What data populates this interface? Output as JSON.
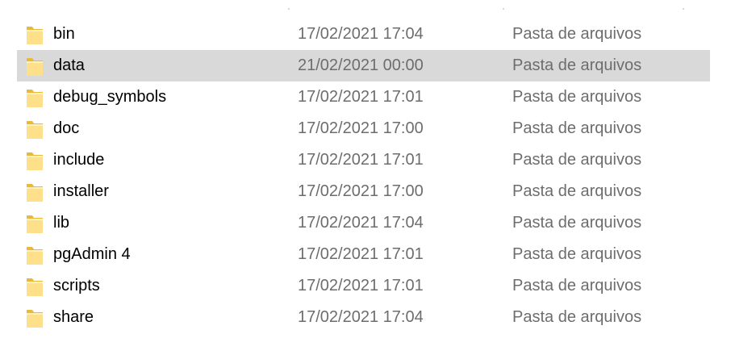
{
  "explorer": {
    "rows": [
      {
        "name": "bin",
        "modified": "17/02/2021 17:04",
        "type": "Pasta de arquivos",
        "icon": "folder-icon",
        "selected": false
      },
      {
        "name": "data",
        "modified": "21/02/2021 00:00",
        "type": "Pasta de arquivos",
        "icon": "folder-icon",
        "selected": true
      },
      {
        "name": "debug_symbols",
        "modified": "17/02/2021 17:01",
        "type": "Pasta de arquivos",
        "icon": "folder-icon",
        "selected": false
      },
      {
        "name": "doc",
        "modified": "17/02/2021 17:00",
        "type": "Pasta de arquivos",
        "icon": "folder-icon",
        "selected": false
      },
      {
        "name": "include",
        "modified": "17/02/2021 17:01",
        "type": "Pasta de arquivos",
        "icon": "folder-icon",
        "selected": false
      },
      {
        "name": "installer",
        "modified": "17/02/2021 17:00",
        "type": "Pasta de arquivos",
        "icon": "folder-icon",
        "selected": false
      },
      {
        "name": "lib",
        "modified": "17/02/2021 17:04",
        "type": "Pasta de arquivos",
        "icon": "folder-icon",
        "selected": false
      },
      {
        "name": "pgAdmin 4",
        "modified": "17/02/2021 17:01",
        "type": "Pasta de arquivos",
        "icon": "folder-icon",
        "selected": false
      },
      {
        "name": "scripts",
        "modified": "17/02/2021 17:01",
        "type": "Pasta de arquivos",
        "icon": "folder-icon",
        "selected": false
      },
      {
        "name": "share",
        "modified": "17/02/2021 17:04",
        "type": "Pasta de arquivos",
        "icon": "folder-icon",
        "selected": false
      }
    ]
  },
  "colors": {
    "selected_row": "#d9d9d9",
    "secondary_text": "#6d6d6d",
    "folder_fill": "#ffe08a",
    "folder_tab": "#e8b93a"
  }
}
